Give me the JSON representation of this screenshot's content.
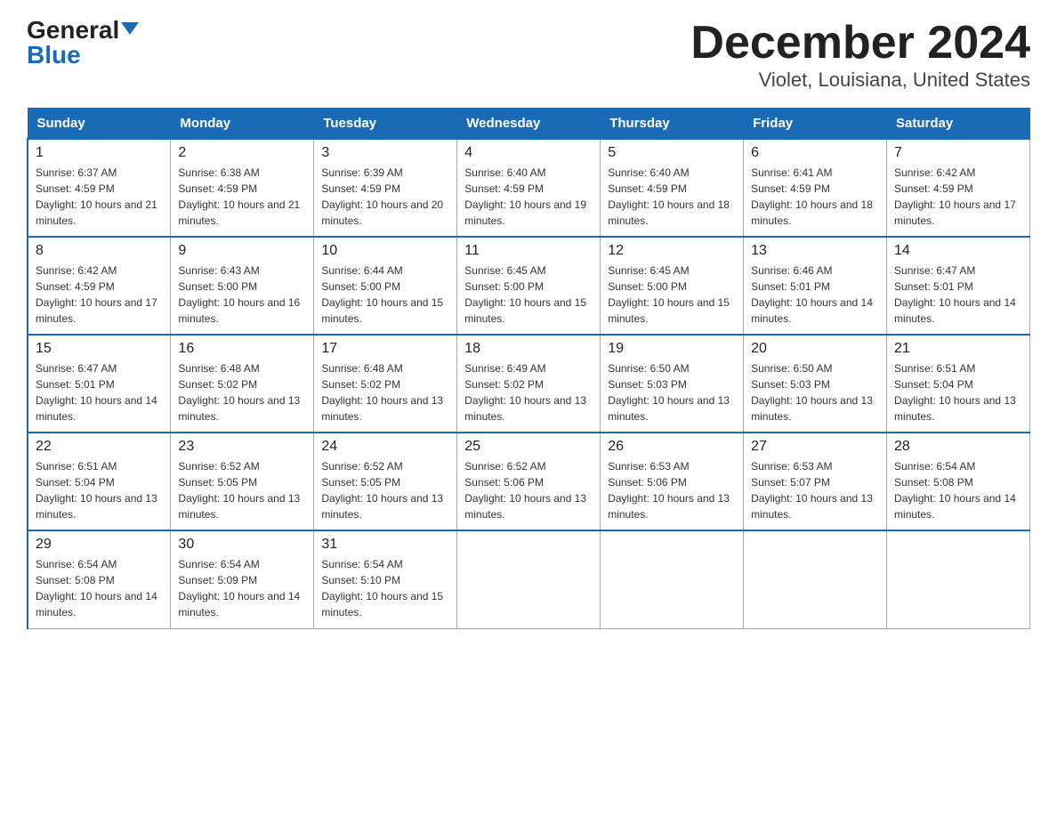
{
  "header": {
    "logo_text_black": "General",
    "logo_text_blue": "Blue",
    "title": "December 2024",
    "subtitle": "Violet, Louisiana, United States"
  },
  "calendar": {
    "weekdays": [
      "Sunday",
      "Monday",
      "Tuesday",
      "Wednesday",
      "Thursday",
      "Friday",
      "Saturday"
    ],
    "weeks": [
      [
        {
          "day": "1",
          "sunrise": "6:37 AM",
          "sunset": "4:59 PM",
          "daylight": "10 hours and 21 minutes."
        },
        {
          "day": "2",
          "sunrise": "6:38 AM",
          "sunset": "4:59 PM",
          "daylight": "10 hours and 21 minutes."
        },
        {
          "day": "3",
          "sunrise": "6:39 AM",
          "sunset": "4:59 PM",
          "daylight": "10 hours and 20 minutes."
        },
        {
          "day": "4",
          "sunrise": "6:40 AM",
          "sunset": "4:59 PM",
          "daylight": "10 hours and 19 minutes."
        },
        {
          "day": "5",
          "sunrise": "6:40 AM",
          "sunset": "4:59 PM",
          "daylight": "10 hours and 18 minutes."
        },
        {
          "day": "6",
          "sunrise": "6:41 AM",
          "sunset": "4:59 PM",
          "daylight": "10 hours and 18 minutes."
        },
        {
          "day": "7",
          "sunrise": "6:42 AM",
          "sunset": "4:59 PM",
          "daylight": "10 hours and 17 minutes."
        }
      ],
      [
        {
          "day": "8",
          "sunrise": "6:42 AM",
          "sunset": "4:59 PM",
          "daylight": "10 hours and 17 minutes."
        },
        {
          "day": "9",
          "sunrise": "6:43 AM",
          "sunset": "5:00 PM",
          "daylight": "10 hours and 16 minutes."
        },
        {
          "day": "10",
          "sunrise": "6:44 AM",
          "sunset": "5:00 PM",
          "daylight": "10 hours and 15 minutes."
        },
        {
          "day": "11",
          "sunrise": "6:45 AM",
          "sunset": "5:00 PM",
          "daylight": "10 hours and 15 minutes."
        },
        {
          "day": "12",
          "sunrise": "6:45 AM",
          "sunset": "5:00 PM",
          "daylight": "10 hours and 15 minutes."
        },
        {
          "day": "13",
          "sunrise": "6:46 AM",
          "sunset": "5:01 PM",
          "daylight": "10 hours and 14 minutes."
        },
        {
          "day": "14",
          "sunrise": "6:47 AM",
          "sunset": "5:01 PM",
          "daylight": "10 hours and 14 minutes."
        }
      ],
      [
        {
          "day": "15",
          "sunrise": "6:47 AM",
          "sunset": "5:01 PM",
          "daylight": "10 hours and 14 minutes."
        },
        {
          "day": "16",
          "sunrise": "6:48 AM",
          "sunset": "5:02 PM",
          "daylight": "10 hours and 13 minutes."
        },
        {
          "day": "17",
          "sunrise": "6:48 AM",
          "sunset": "5:02 PM",
          "daylight": "10 hours and 13 minutes."
        },
        {
          "day": "18",
          "sunrise": "6:49 AM",
          "sunset": "5:02 PM",
          "daylight": "10 hours and 13 minutes."
        },
        {
          "day": "19",
          "sunrise": "6:50 AM",
          "sunset": "5:03 PM",
          "daylight": "10 hours and 13 minutes."
        },
        {
          "day": "20",
          "sunrise": "6:50 AM",
          "sunset": "5:03 PM",
          "daylight": "10 hours and 13 minutes."
        },
        {
          "day": "21",
          "sunrise": "6:51 AM",
          "sunset": "5:04 PM",
          "daylight": "10 hours and 13 minutes."
        }
      ],
      [
        {
          "day": "22",
          "sunrise": "6:51 AM",
          "sunset": "5:04 PM",
          "daylight": "10 hours and 13 minutes."
        },
        {
          "day": "23",
          "sunrise": "6:52 AM",
          "sunset": "5:05 PM",
          "daylight": "10 hours and 13 minutes."
        },
        {
          "day": "24",
          "sunrise": "6:52 AM",
          "sunset": "5:05 PM",
          "daylight": "10 hours and 13 minutes."
        },
        {
          "day": "25",
          "sunrise": "6:52 AM",
          "sunset": "5:06 PM",
          "daylight": "10 hours and 13 minutes."
        },
        {
          "day": "26",
          "sunrise": "6:53 AM",
          "sunset": "5:06 PM",
          "daylight": "10 hours and 13 minutes."
        },
        {
          "day": "27",
          "sunrise": "6:53 AM",
          "sunset": "5:07 PM",
          "daylight": "10 hours and 13 minutes."
        },
        {
          "day": "28",
          "sunrise": "6:54 AM",
          "sunset": "5:08 PM",
          "daylight": "10 hours and 14 minutes."
        }
      ],
      [
        {
          "day": "29",
          "sunrise": "6:54 AM",
          "sunset": "5:08 PM",
          "daylight": "10 hours and 14 minutes."
        },
        {
          "day": "30",
          "sunrise": "6:54 AM",
          "sunset": "5:09 PM",
          "daylight": "10 hours and 14 minutes."
        },
        {
          "day": "31",
          "sunrise": "6:54 AM",
          "sunset": "5:10 PM",
          "daylight": "10 hours and 15 minutes."
        },
        null,
        null,
        null,
        null
      ]
    ]
  }
}
